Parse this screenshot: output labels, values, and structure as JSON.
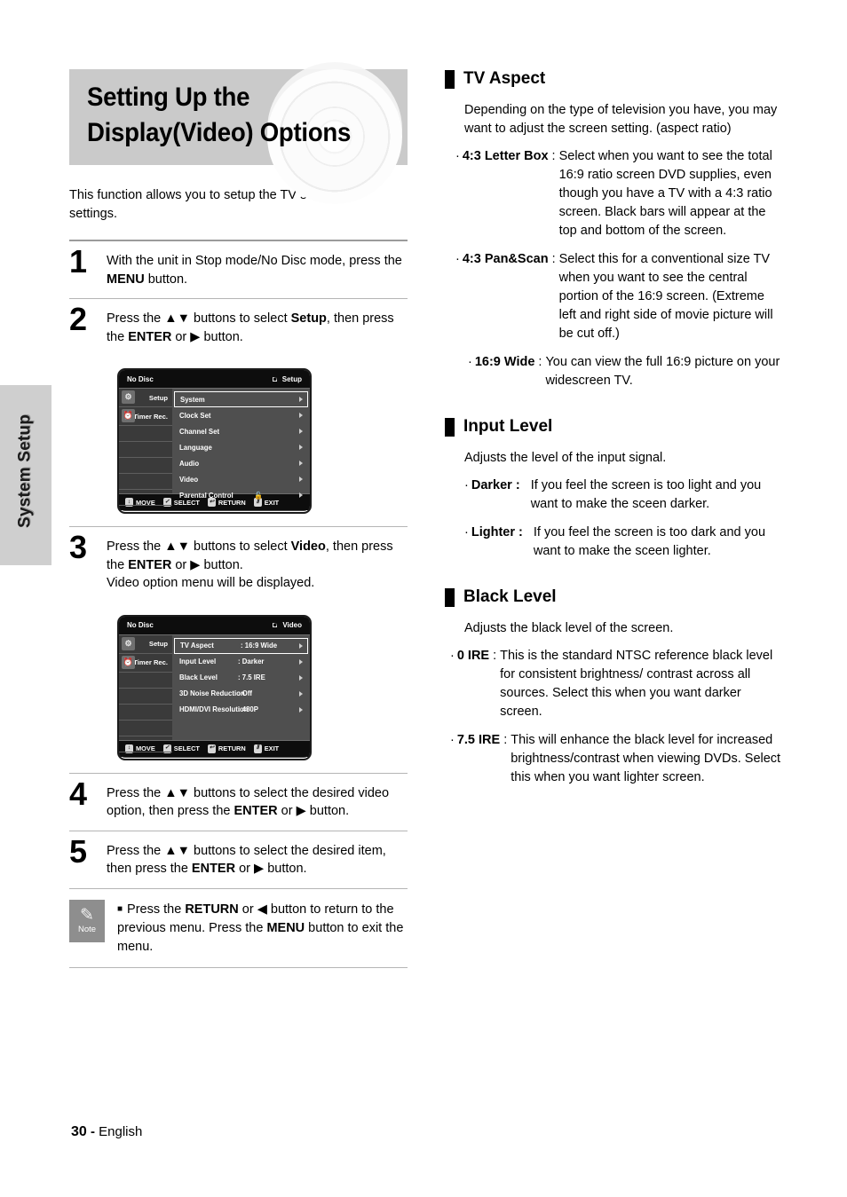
{
  "sidebar_tab": {
    "label": "System Setup"
  },
  "banner": {
    "title_line1": "Setting Up the",
    "title_line2": "Display(Video) Options",
    "disc_icon": "dvd-disc-icon"
  },
  "intro": "This function allows you to setup the TV screen settings.",
  "steps": [
    {
      "number": "1",
      "parts": [
        {
          "t": "With the unit in Stop mode/No Disc mode, press the ",
          "b": false
        },
        {
          "t": "MENU",
          "b": true
        },
        {
          "t": " button.",
          "b": false
        }
      ]
    },
    {
      "number": "2",
      "parts": [
        {
          "t": "Press the ▲▼ buttons to select ",
          "b": false
        },
        {
          "t": "Setup",
          "b": true
        },
        {
          "t": ", then press the ",
          "b": false
        },
        {
          "t": "ENTER",
          "b": true
        },
        {
          "t": " or ▶ button.",
          "b": false
        }
      ]
    },
    {
      "number": "3",
      "parts": [
        {
          "t": "Press the ▲▼ buttons to select ",
          "b": false
        },
        {
          "t": "Video",
          "b": true
        },
        {
          "t": ", then press the ",
          "b": false
        },
        {
          "t": "ENTER",
          "b": true
        },
        {
          "t": " or ▶ button.",
          "b": false
        },
        {
          "t": "Video option menu will be displayed.",
          "b": false,
          "br": true
        }
      ]
    },
    {
      "number": "4",
      "parts": [
        {
          "t": "Press the ▲▼ buttons to select the desired video option, then press the ",
          "b": false
        },
        {
          "t": "ENTER",
          "b": true
        },
        {
          "t": " or ▶ button.",
          "b": false
        }
      ]
    },
    {
      "number": "5",
      "parts": [
        {
          "t": "Press the ▲▼ buttons to select the desired item, then press the ",
          "b": false
        },
        {
          "t": "ENTER",
          "b": true
        },
        {
          "t": " or ▶ button.",
          "b": false
        }
      ]
    }
  ],
  "osd_setup": {
    "header_left": "No Disc",
    "header_right": "Setup",
    "left_items": [
      {
        "label": "Setup",
        "icon": "gear-icon"
      },
      {
        "label": "Timer Rec.",
        "icon": "clock-icon"
      }
    ],
    "rows": [
      {
        "label": "System",
        "selected": true
      },
      {
        "label": "Clock Set",
        "selected": false
      },
      {
        "label": "Channel Set",
        "selected": false
      },
      {
        "label": "Language",
        "selected": false
      },
      {
        "label": "Audio",
        "selected": false
      },
      {
        "label": "Video",
        "selected": false
      },
      {
        "label": "Parental Control",
        "selected": false,
        "lock": "🔓"
      }
    ],
    "footer": [
      {
        "key": "↕",
        "label": "MOVE"
      },
      {
        "key": "✓",
        "label": "SELECT"
      },
      {
        "key": "↩",
        "label": "RETURN"
      },
      {
        "key": "Ⅱ",
        "label": "EXIT"
      }
    ]
  },
  "osd_video": {
    "header_left": "No Disc",
    "header_right": "Video",
    "left_items": [
      {
        "label": "Setup",
        "icon": "gear-icon"
      },
      {
        "label": "Timer Rec.",
        "icon": "clock-icon"
      }
    ],
    "rows": [
      {
        "label": "TV Aspect",
        "value": ": 16:9 Wide",
        "selected": true
      },
      {
        "label": "Input Level",
        "value": ": Darker",
        "selected": false
      },
      {
        "label": "Black Level",
        "value": ": 7.5 IRE",
        "selected": false
      },
      {
        "label": "3D Noise Reduction",
        "value": ": Off",
        "selected": false
      },
      {
        "label": "HDMI/DVI Resolution",
        "value": ": 480P",
        "selected": false
      }
    ],
    "footer": [
      {
        "key": "↕",
        "label": "MOVE"
      },
      {
        "key": "✓",
        "label": "SELECT"
      },
      {
        "key": "↩",
        "label": "RETURN"
      },
      {
        "key": "Ⅱ",
        "label": "EXIT"
      }
    ]
  },
  "note": {
    "icon_label": "Note",
    "bullet": "■",
    "parts": [
      {
        "t": "Press the ",
        "b": false
      },
      {
        "t": "RETURN",
        "b": true
      },
      {
        "t": " or ◀ button to return to the previous menu. Press the ",
        "b": false
      },
      {
        "t": "MENU",
        "b": true
      },
      {
        "t": " button to exit the menu.",
        "b": false
      }
    ]
  },
  "sections": [
    {
      "title": "TV Aspect",
      "para": "Depending on the type of television you have, you may want to adjust the screen setting. (aspect ratio)",
      "bullets": [
        {
          "term": "4:3 Letter Box",
          "desc": "Select when you want to see the total 16:9 ratio screen DVD supplies, even though you have a TV with a 4:3 ratio screen. Black bars will appear at the top and bottom of the screen."
        },
        {
          "term": "4:3 Pan&Scan",
          "desc": "Select this for a conventional size TV when you want to see the central portion of the 16:9 screen. (Extreme left and right side of movie picture will be cut off.)"
        },
        {
          "term": "16:9 Wide",
          "desc": "You can view the full 16:9 picture on your widescreen TV."
        }
      ]
    },
    {
      "title": "Input Level",
      "para": "Adjusts the level of the input signal.",
      "bullets": [
        {
          "term": "Darker :",
          "desc": "If you feel the screen is too light and you want to make the sceen darker."
        },
        {
          "term": "Lighter :",
          "desc": "If you feel the screen is too dark and you want to make the sceen lighter."
        }
      ]
    },
    {
      "title": "Black Level",
      "para": "Adjusts the black level of the screen.",
      "bullets": [
        {
          "term": "0 IRE",
          "desc": "This is the standard NTSC reference black level for consistent brightness/ contrast across all sources. Select this when you want darker screen."
        },
        {
          "term": "7.5 IRE",
          "desc": "This will  enhance the black level for increased brightness/contrast when viewing DVDs. Select this when you want lighter screen."
        }
      ]
    }
  ],
  "footer": {
    "page": "30",
    "dash": "-",
    "language": "English"
  },
  "colors": {
    "banner_bg": "#cacaca",
    "tab_bg": "#cfcfcf",
    "rule": "#9b9b9b",
    "osd_bg": "#4b4b4b",
    "note_icon_bg": "#8e8e8e"
  }
}
